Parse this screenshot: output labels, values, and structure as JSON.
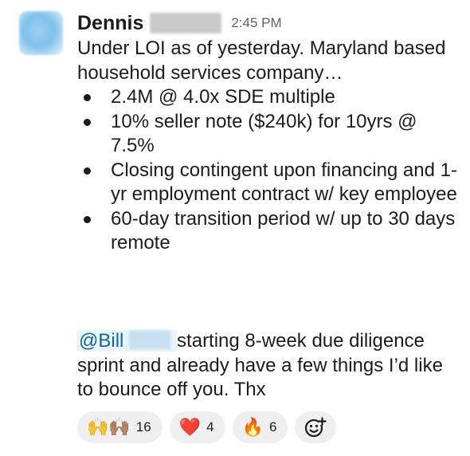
{
  "message": {
    "sender": "Dennis",
    "timestamp": "2:45 PM",
    "intro": "Under LOI as of yesterday. Maryland based household services company…",
    "bullets": [
      "2.4M @ 4.0x SDE multiple",
      "10% seller note ($240k) for 10yrs @ 7.5%",
      "Closing contingent upon financing and 1-yr employment contract w/ key employee",
      "60-day transition period w/ up to 30 days remote"
    ]
  },
  "followup": {
    "mention": "@Bill",
    "text": "starting 8-week due diligence sprint and already have a few things I’d like to bounce off you. Thx"
  },
  "reactions": [
    {
      "emoji": "🙌🙌🏽",
      "icon": "raised-hands-icon",
      "count": "16"
    },
    {
      "emoji": "❤️",
      "icon": "heart-icon",
      "count": "4"
    },
    {
      "emoji": "🔥",
      "icon": "fire-icon",
      "count": "6"
    }
  ],
  "add_reaction_icon": "add-reaction-icon"
}
